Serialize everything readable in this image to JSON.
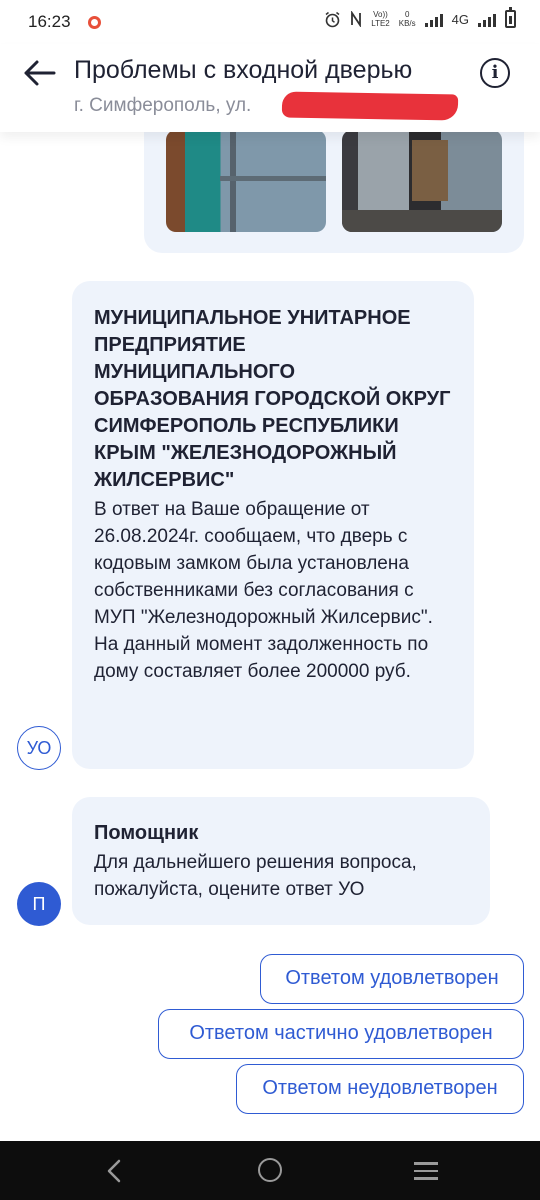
{
  "status_bar": {
    "time": "16:23",
    "volte_top": "Vo))",
    "volte_bottom": "LTE2",
    "speed_value": "0",
    "speed_unit": "KB/s",
    "network": "4G"
  },
  "header": {
    "title": "Проблемы с входной дверью",
    "address": "г. Симферополь, ул."
  },
  "uo_message": {
    "avatar": "УО",
    "organization": "МУНИЦИПАЛЬНОЕ УНИТАРНОЕ ПРЕДПРИЯТИЕ МУНИЦИПАЛЬНОГО ОБРАЗОВАНИЯ ГОРОДСКОЙ ОКРУГ СИМФЕРОПОЛЬ РЕСПУБЛИКИ КРЫМ \"ЖЕЛЕЗНОДОРОЖНЫЙ ЖИЛСЕРВИС\"",
    "text": "В ответ на Ваше обращение от 26.08.2024г. сообщаем, что дверь с кодовым замком была установлена собственниками без согласования с МУП \"Железнодорожный Жилсервис\". На данный момент задолженность по дому составляет более 200000 руб."
  },
  "helper_message": {
    "avatar": "П",
    "name": "Помощник",
    "text": "Для дальнейшего решения вопроса, пожалуйста, оцените ответ УО"
  },
  "replies": {
    "satisfied": "Ответом удовлетворен",
    "partial": "Ответом частично удовлетворен",
    "unsatisfied": "Ответом неудовлетворен"
  },
  "colors": {
    "accent": "#2f5bd3",
    "bubble": "#eef3fb",
    "redaction": "#e8323b"
  }
}
